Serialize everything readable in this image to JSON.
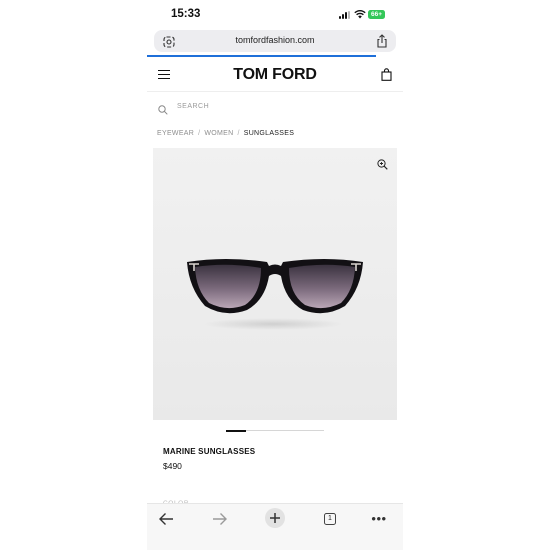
{
  "status_bar": {
    "time": "15:33",
    "battery": "66+"
  },
  "browser": {
    "url": "tomfordfashion.com",
    "open_tabs": "1"
  },
  "site": {
    "logo": "TOM FORD",
    "search_placeholder": "SEARCH",
    "breadcrumb": [
      "EYEWEAR",
      "WOMEN",
      "SUNGLASSES"
    ]
  },
  "product": {
    "name": "MARINE SUNGLASSES",
    "price": "$490",
    "color_label": "COLOR",
    "image_icon": "sunglasses-image"
  },
  "icons": [
    "lens-icon",
    "share-icon",
    "menu-icon",
    "bag-icon",
    "search-icon",
    "zoom-icon",
    "back-arrow-icon",
    "forward-arrow-icon",
    "plus-icon",
    "tabs-icon",
    "more-icon"
  ],
  "colors": {
    "accent_progress": "#1e6fd9",
    "battery": "#34c759"
  }
}
